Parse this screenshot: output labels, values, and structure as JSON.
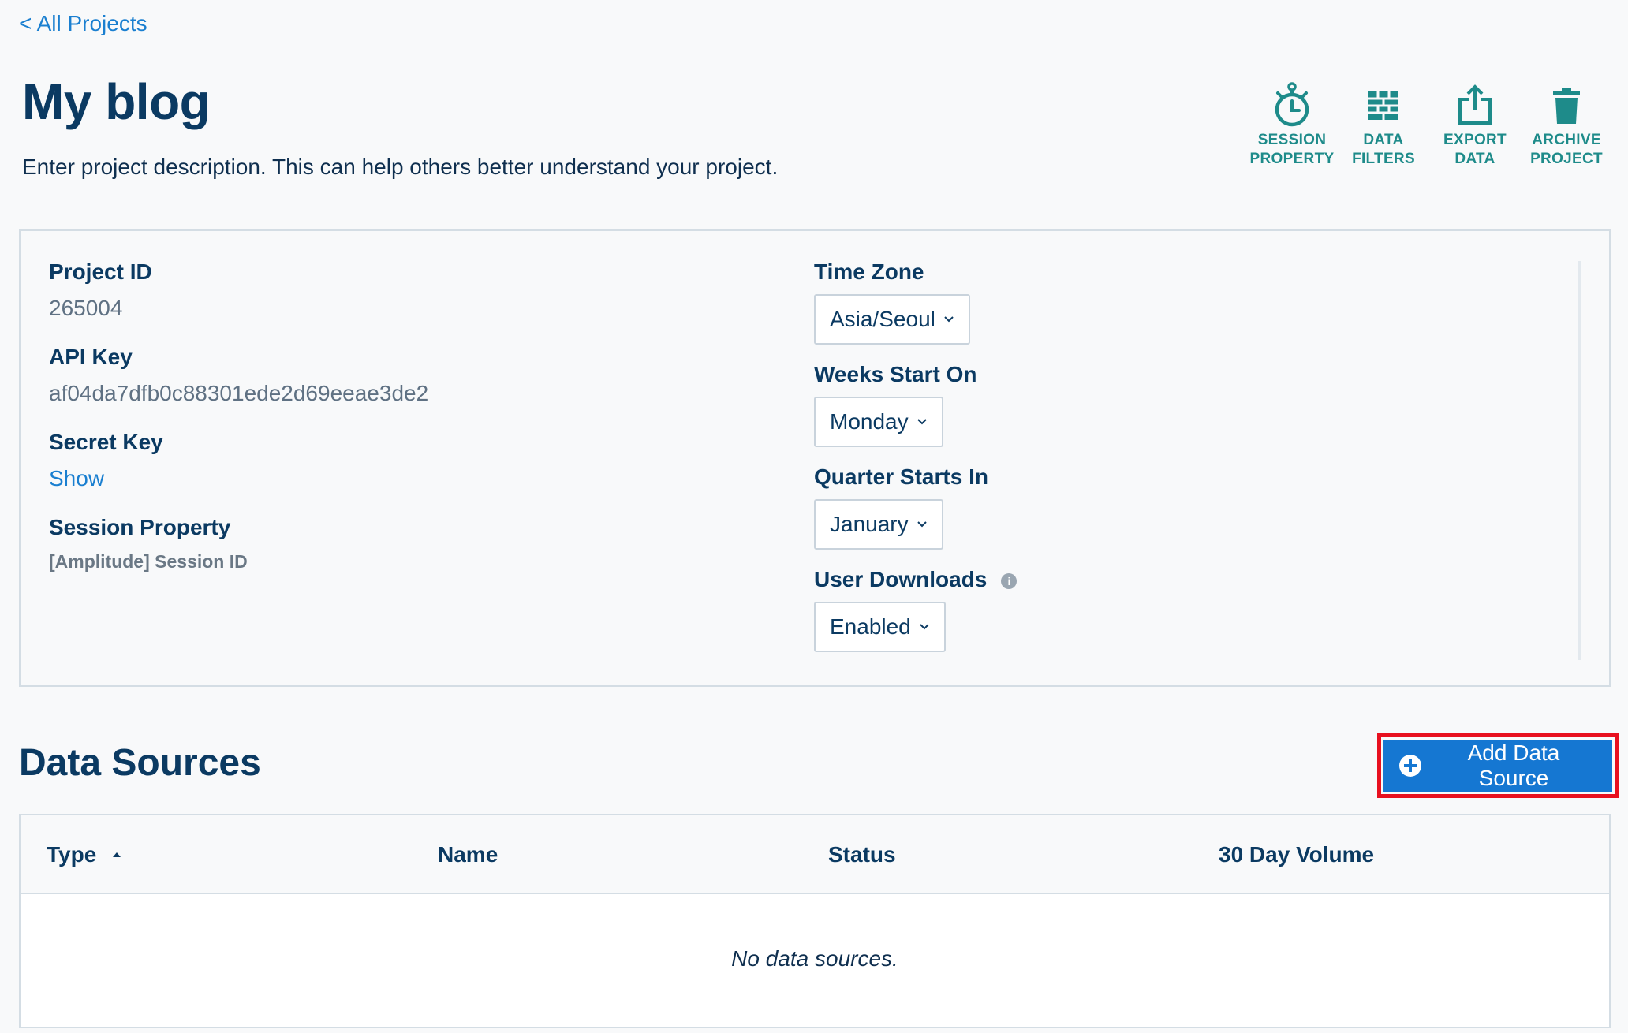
{
  "nav": {
    "back_label": "< All Projects"
  },
  "project": {
    "title": "My blog",
    "description": "Enter project description. This can help others better understand your project."
  },
  "actions": [
    {
      "label": "SESSION\nPROPERTY",
      "icon": "stopwatch-icon"
    },
    {
      "label": "DATA\nFILTERS",
      "icon": "brick-wall-icon"
    },
    {
      "label": "EXPORT\nDATA",
      "icon": "export-icon"
    },
    {
      "label": "ARCHIVE\nPROJECT",
      "icon": "trash-icon"
    }
  ],
  "details": {
    "project_id_label": "Project ID",
    "project_id": "265004",
    "api_key_label": "API Key",
    "api_key": "af04da7dfb0c88301ede2d69eeae3de2",
    "secret_key_label": "Secret Key",
    "secret_key_action": "Show",
    "session_property_label": "Session Property",
    "session_property": "[Amplitude] Session ID"
  },
  "settings": {
    "time_zone_label": "Time Zone",
    "time_zone": "Asia/Seoul",
    "week_start_label": "Weeks Start On",
    "week_start": "Monday",
    "quarter_start_label": "Quarter Starts In",
    "quarter_start": "January",
    "user_downloads_label": "User Downloads",
    "user_downloads": "Enabled"
  },
  "data_sources": {
    "title": "Data Sources",
    "add_button": "Add Data Source",
    "columns": [
      "Type",
      "Name",
      "Status",
      "30 Day Volume"
    ],
    "empty_message": "No data sources."
  },
  "colors": {
    "accent_teal": "#1e8b8a",
    "primary_blue": "#1577d2",
    "link_blue": "#1a7fd0",
    "highlight_red": "#e8101f",
    "heading_navy": "#0b3a62"
  }
}
